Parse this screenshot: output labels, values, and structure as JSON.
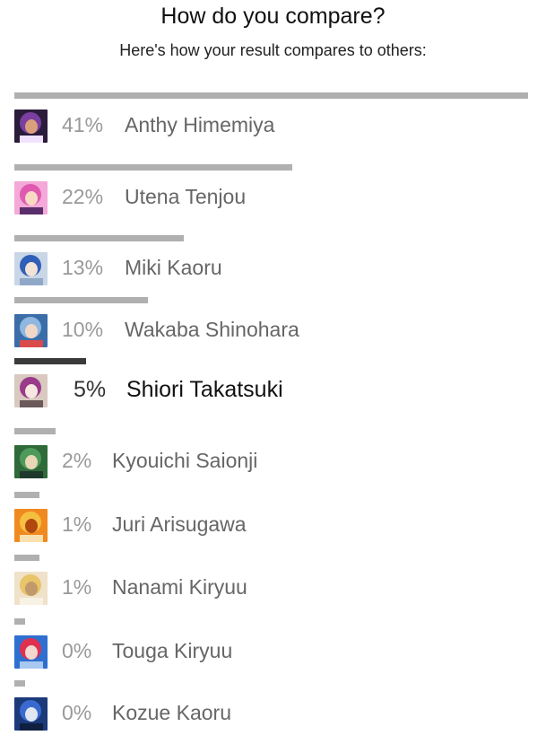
{
  "header": {
    "title": "How do you compare?",
    "subtitle": "Here's how your result compares to others:"
  },
  "colors": {
    "bar": "#b0b0b0",
    "bar_highlight": "#3a3a3a",
    "percent_text": "#999999",
    "name_text": "#666666",
    "highlight_text": "#111111"
  },
  "chart_data": {
    "type": "bar",
    "orientation": "horizontal",
    "title": "How do you compare?",
    "subtitle": "Here's how your result compares to others:",
    "xlim": [
      0,
      41
    ],
    "highlighted": "Shiori Takatsuki",
    "categories": [
      "Anthy Himemiya",
      "Utena Tenjou",
      "Miki Kaoru",
      "Wakaba Shinohara",
      "Shiori Takatsuki",
      "Kyouichi Saionji",
      "Juri Arisugawa",
      "Nanami Kiryuu",
      "Touga Kiryuu",
      "Kozue Kaoru"
    ],
    "values": [
      41,
      22,
      13,
      10,
      5,
      2,
      1,
      1,
      0,
      0
    ],
    "labels": [
      "41%",
      "22%",
      "13%",
      "10%",
      "5%",
      "2%",
      "1%",
      "1%",
      "0%",
      "0%"
    ],
    "thumbnails": [
      "anthy-avatar",
      "utena-avatar",
      "miki-avatar",
      "wakaba-avatar",
      "shiori-avatar",
      "kyouichi-avatar",
      "juri-avatar",
      "nanami-avatar",
      "touga-avatar",
      "kozue-avatar"
    ]
  }
}
